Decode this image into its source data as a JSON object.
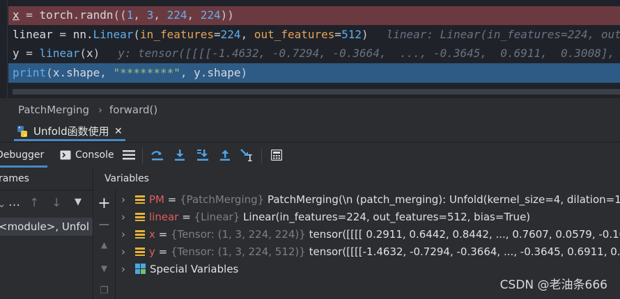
{
  "editor": {
    "line1": {
      "var": "x",
      "eq": " = ",
      "mod": "torch.",
      "fn": "randn",
      "open": "((",
      "n1": "1",
      "c1": ", ",
      "n2": "3",
      "c2": ", ",
      "n3": "224",
      "c3": ", ",
      "n4": "224",
      "close": "))"
    },
    "line2": {
      "var": "linear",
      "eq": " = ",
      "mod": "nn.",
      "fn": "Linear",
      "open": "(",
      "p1": "in_features",
      "e1": "=",
      "v1": "224",
      "c1": ", ",
      "p2": "out_features",
      "e2": "=",
      "v2": "512",
      "close": ")",
      "hint": "linear: Linear(in_features=224, out_"
    },
    "line3": {
      "var": "y",
      "eq": " = ",
      "fn": "linear",
      "open": "(",
      "arg": "x",
      "close": ")",
      "hint": "y: tensor([[[[-1.4632, -0.7294, -0.3664,  ..., -0.3645,  0.6911,  0.3008],"
    },
    "line4": {
      "fn": "print",
      "open": "(",
      "a1": "x.shape",
      "c1": ", ",
      "str": "\"********\"",
      "c2": ", ",
      "a2": "y.shape",
      "close": ")"
    }
  },
  "breadcrumb": {
    "item1": "PatchMerging",
    "sep": "›",
    "item2": "forward()"
  },
  "tab": {
    "label": "Unfold函数使用",
    "close": "✕"
  },
  "toolbar": {
    "debugger": "Debugger",
    "console": "Console"
  },
  "frames": {
    "title": "rames",
    "frame": "<module>, Unfol"
  },
  "variables": {
    "title": "Variables",
    "rows": [
      {
        "name": "PM",
        "eq": " = ",
        "type": "{PatchMerging}",
        "value": "PatchMerging(\\n  (patch_merging): Unfold(kernel_size=4, dilation=1, p"
      },
      {
        "name": "linear",
        "eq": " = ",
        "type": "{Linear}",
        "value": "Linear(in_features=224, out_features=512, bias=True)"
      },
      {
        "name": "x",
        "eq": " = ",
        "type": "{Tensor: (1, 3, 224, 224)}",
        "value": "tensor([[[[ 0.2911,  0.6442,  0.8442,  ...,  0.7607,  0.0579, -0.1072],"
      },
      {
        "name": "y",
        "eq": " = ",
        "type": "{Tensor: (1, 3, 224, 512)}",
        "value": "tensor([[[[-1.4632, -0.7294, -0.3664,  ..., -0.3645,  0.6911,  0.3008],"
      },
      {
        "name": "Special Variables"
      }
    ]
  },
  "watermark": "CSDN @老油条666",
  "colors": {
    "accent": "#4a88c7",
    "error_line": "#6b3a40",
    "selection": "#2e5b86",
    "var_name": "#e25d5d"
  }
}
